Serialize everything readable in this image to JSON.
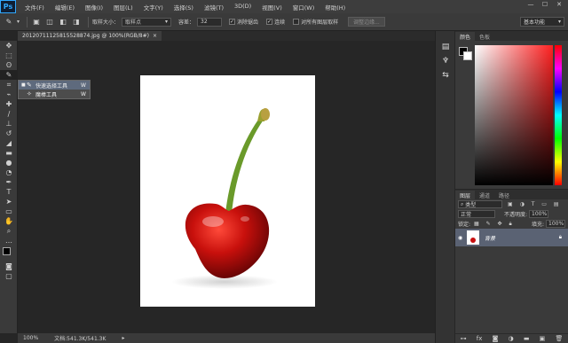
{
  "app": {
    "logo": "Ps"
  },
  "menu": [
    "文件(F)",
    "编辑(E)",
    "图像(I)",
    "图层(L)",
    "文字(Y)",
    "选择(S)",
    "滤镜(T)",
    "3D(D)",
    "视图(V)",
    "窗口(W)",
    "帮助(H)"
  ],
  "window_controls": {
    "minimize": "—",
    "maximize": "☐",
    "close": "✕"
  },
  "options": {
    "brush_size_label": "取样大小：",
    "brush_size_value": "取样点",
    "tolerance_label": "容差：",
    "tolerance_value": "32",
    "antialias_label": "消除锯齿",
    "contiguous_label": "连续",
    "sample_all_label": "对所有图层取样",
    "refine_edge_label": "调整边缘...",
    "workspace": "基本功能"
  },
  "document": {
    "tab_title": "20120711125815528874.jpg @ 100%(RGB/8#)",
    "tab_close": "×"
  },
  "flyout": {
    "items": [
      {
        "label": "快速选择工具",
        "key": "W"
      },
      {
        "label": "魔棒工具",
        "key": "W"
      }
    ]
  },
  "status": {
    "zoom": "100%",
    "doc_info": "文档:541.3K/541.3K"
  },
  "color_panel": {
    "tabs": [
      "颜色",
      "色板"
    ]
  },
  "layers_panel": {
    "tabs": [
      "图层",
      "通道",
      "路径"
    ],
    "kind_label": "类型",
    "blend_mode": "正常",
    "opacity_label": "不透明度:",
    "opacity_value": "100%",
    "lock_label": "锁定:",
    "fill_label": "填充:",
    "fill_value": "100%",
    "layer_name": "背景"
  },
  "colors": {
    "fg": "#000000",
    "bg": "#ffffff",
    "hue": "#ff2020"
  }
}
